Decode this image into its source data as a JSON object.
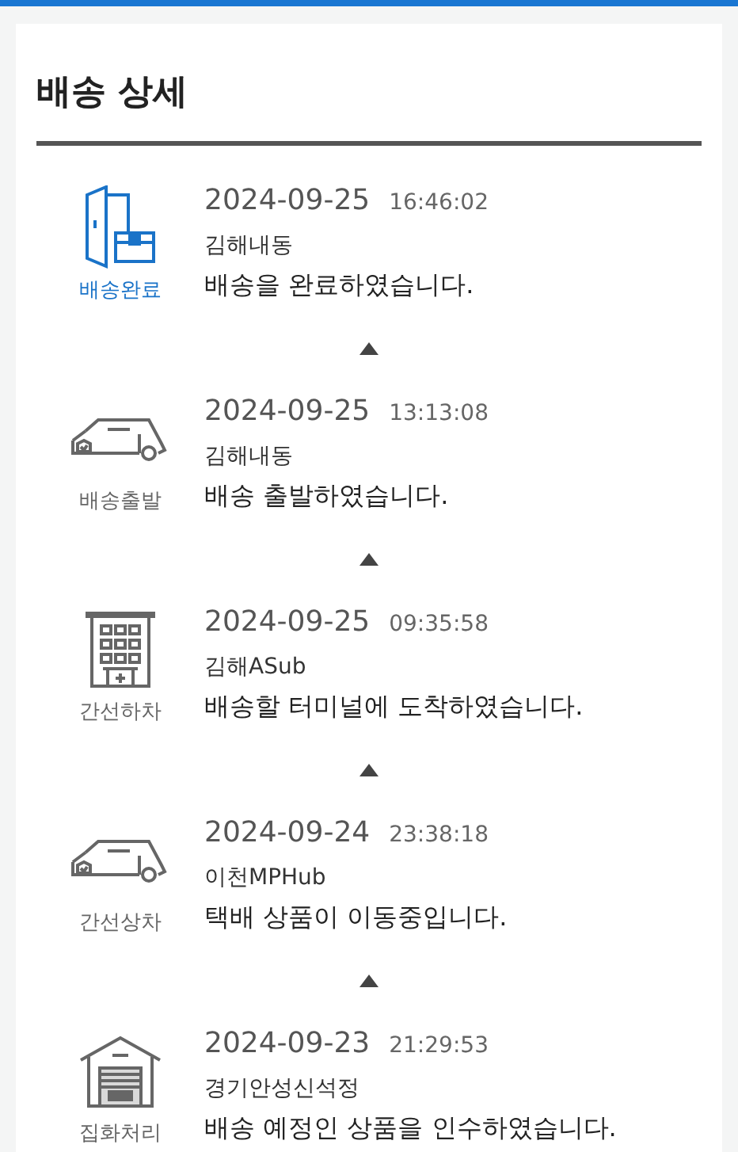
{
  "title": "배송 상세",
  "events": [
    {
      "kind": "delivered",
      "status": "배송완료",
      "current": true,
      "date": "2024-09-25",
      "time": "16:46:02",
      "location": "김해내동",
      "message": "배송을 완료하였습니다."
    },
    {
      "kind": "truck",
      "status": "배송출발",
      "current": false,
      "date": "2024-09-25",
      "time": "13:13:08",
      "location": "김해내동",
      "message": "배송 출발하였습니다."
    },
    {
      "kind": "building",
      "status": "간선하차",
      "current": false,
      "date": "2024-09-25",
      "time": "09:35:58",
      "location": "김해ASub",
      "message": "배송할 터미널에 도착하였습니다."
    },
    {
      "kind": "truck",
      "status": "간선상차",
      "current": false,
      "date": "2024-09-24",
      "time": "23:38:18",
      "location": "이천MPHub",
      "message": "택배 상품이 이동중입니다."
    },
    {
      "kind": "warehouse",
      "status": "집화처리",
      "current": false,
      "date": "2024-09-23",
      "time": "21:29:53",
      "location": "경기안성신석정",
      "message": "배송 예정인 상품을 인수하였습니다."
    }
  ]
}
